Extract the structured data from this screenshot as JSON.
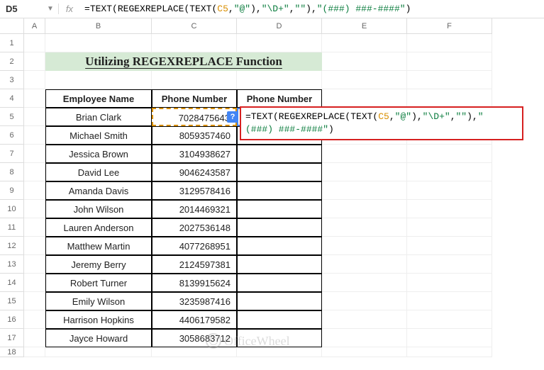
{
  "nameBox": "D5",
  "fxLabel": "fx",
  "formula": {
    "p1": "=TEXT(REGEXREPLACE(TEXT(",
    "p2": "C5",
    "p3": ",",
    "p4": "\"@\"",
    "p5": "),",
    "p6": "\"\\D+\"",
    "p7": ",",
    "p8": "\"\"",
    "p9": "),",
    "p10": "\"(###) ###-####\"",
    "p11": ")"
  },
  "columns": [
    "A",
    "B",
    "C",
    "D",
    "E",
    "F"
  ],
  "rows": [
    "1",
    "2",
    "3",
    "4",
    "5",
    "6",
    "7",
    "8",
    "9",
    "10",
    "11",
    "12",
    "13",
    "14",
    "15",
    "16",
    "17",
    "18"
  ],
  "title": "Utilizing REGEXREPLACE Function",
  "headers": {
    "b": "Employee  Name",
    "c": "Phone Number",
    "d": "Phone Number"
  },
  "data": [
    {
      "name": "Brian Clark",
      "phone": "7028475643"
    },
    {
      "name": "Michael Smith",
      "phone": "8059357460"
    },
    {
      "name": "Jessica Brown",
      "phone": "3104938627"
    },
    {
      "name": "David Lee",
      "phone": "9046243587"
    },
    {
      "name": "Amanda Davis",
      "phone": "3129578416"
    },
    {
      "name": "John Wilson",
      "phone": "2014469321"
    },
    {
      "name": "Lauren Anderson",
      "phone": "2027536148"
    },
    {
      "name": "Matthew Martin",
      "phone": "4077268951"
    },
    {
      "name": "Jeremy Berry",
      "phone": "2124597381"
    },
    {
      "name": "Robert Turner",
      "phone": "8139915624"
    },
    {
      "name": "Emily Wilson",
      "phone": "3235987416"
    },
    {
      "name": "Harrison Hopkins",
      "phone": "4406179582"
    },
    {
      "name": "Jayce Howard",
      "phone": "3058683712"
    }
  ],
  "helpBadge": "?",
  "overlayFormula": {
    "l1a": "=TEXT(REGEXREPLACE(TEXT(",
    "l1b": "C5",
    "l1c": ",",
    "l1d": "\"@\"",
    "l1e": "),",
    "l1f": "\"\\D+\"",
    "l1g": ",",
    "l1h": "\"\"",
    "l1i": "),",
    "l1j": "\"",
    "l2a": "(###) ###-####\"",
    "l2b": ")"
  },
  "watermark": "OfficeWheel"
}
